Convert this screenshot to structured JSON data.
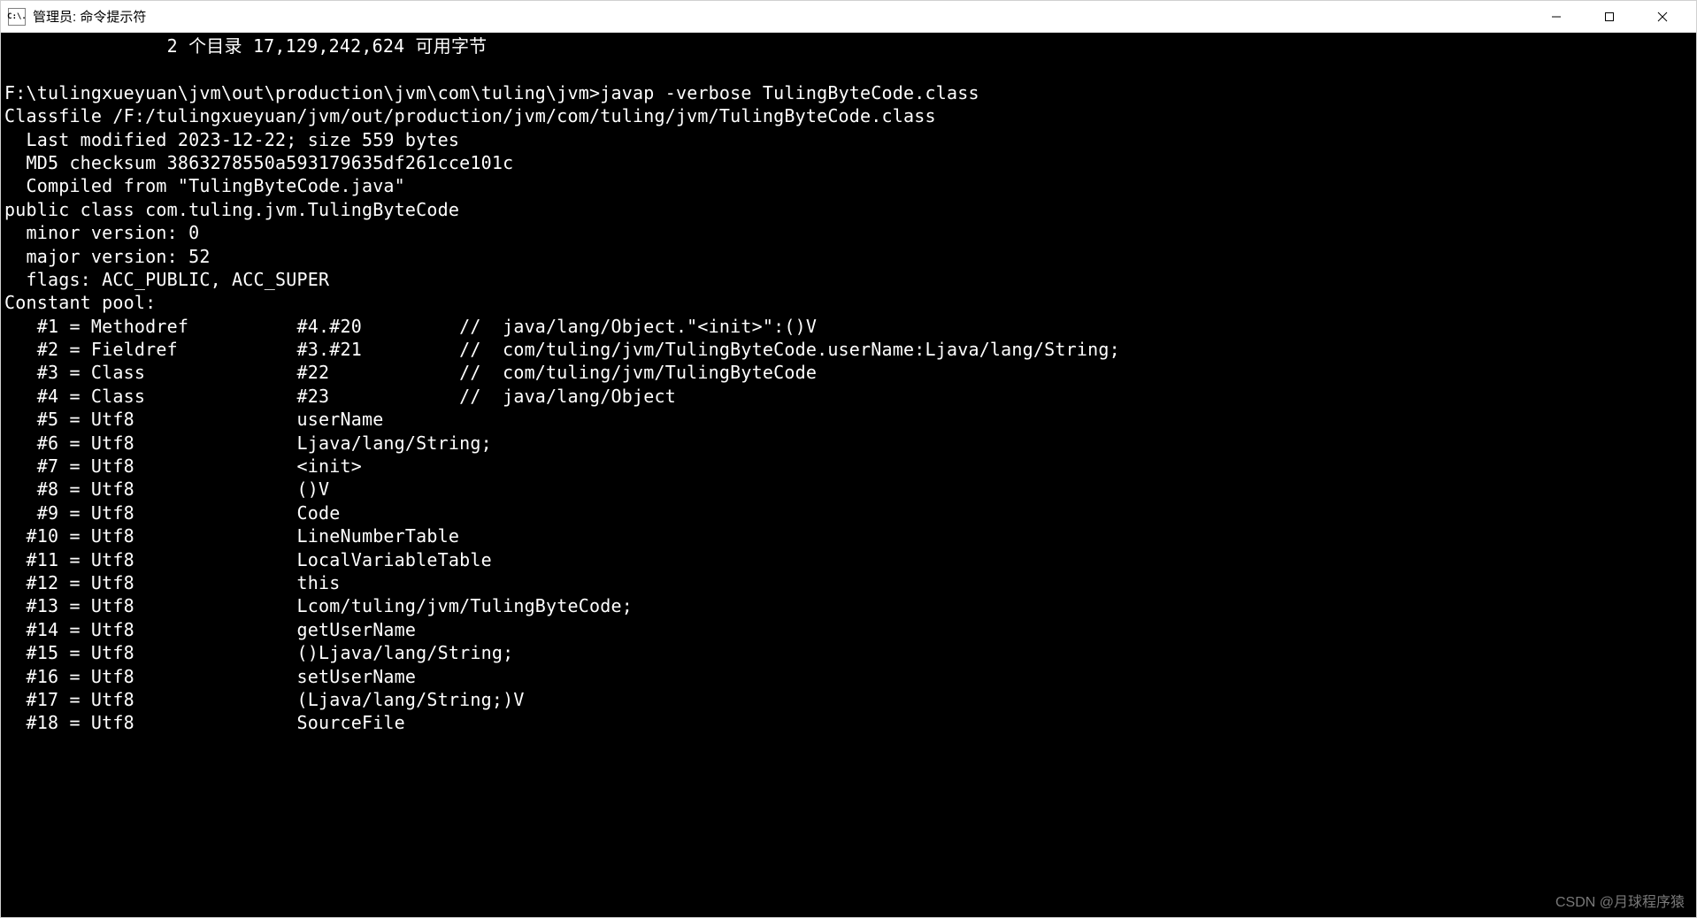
{
  "window": {
    "icon_label": "C:\\.",
    "title": "管理员: 命令提示符"
  },
  "terminal": {
    "dir_summary_prefix": "               2 个目录 17,129,242,624 可用字节",
    "blank": "",
    "prompt_path": "F:\\tulingxueyuan\\jvm\\out\\production\\jvm\\com\\tuling\\jvm>",
    "command": "javap -verbose TulingByteCode.class",
    "classfile": "Classfile /F:/tulingxueyuan/jvm/out/production/jvm/com/tuling/jvm/TulingByteCode.class",
    "last_modified": "  Last modified 2023-12-22; size 559 bytes",
    "md5": "  MD5 checksum 3863278550a593179635df261cce101c",
    "compiled_from": "  Compiled from \"TulingByteCode.java\"",
    "class_decl": "public class com.tuling.jvm.TulingByteCode",
    "minor": "  minor version: 0",
    "major": "  major version: 52",
    "flags": "  flags: ACC_PUBLIC, ACC_SUPER",
    "pool_header": "Constant pool:",
    "pool": [
      "   #1 = Methodref          #4.#20         //  java/lang/Object.\"<init>\":()V",
      "   #2 = Fieldref           #3.#21         //  com/tuling/jvm/TulingByteCode.userName:Ljava/lang/String;",
      "   #3 = Class              #22            //  com/tuling/jvm/TulingByteCode",
      "   #4 = Class              #23            //  java/lang/Object",
      "   #5 = Utf8               userName",
      "   #6 = Utf8               Ljava/lang/String;",
      "   #7 = Utf8               <init>",
      "   #8 = Utf8               ()V",
      "   #9 = Utf8               Code",
      "  #10 = Utf8               LineNumberTable",
      "  #11 = Utf8               LocalVariableTable",
      "  #12 = Utf8               this",
      "  #13 = Utf8               Lcom/tuling/jvm/TulingByteCode;",
      "  #14 = Utf8               getUserName",
      "  #15 = Utf8               ()Ljava/lang/String;",
      "  #16 = Utf8               setUserName",
      "  #17 = Utf8               (Ljava/lang/String;)V",
      "  #18 = Utf8               SourceFile"
    ]
  },
  "watermark": "CSDN @月球程序猿"
}
